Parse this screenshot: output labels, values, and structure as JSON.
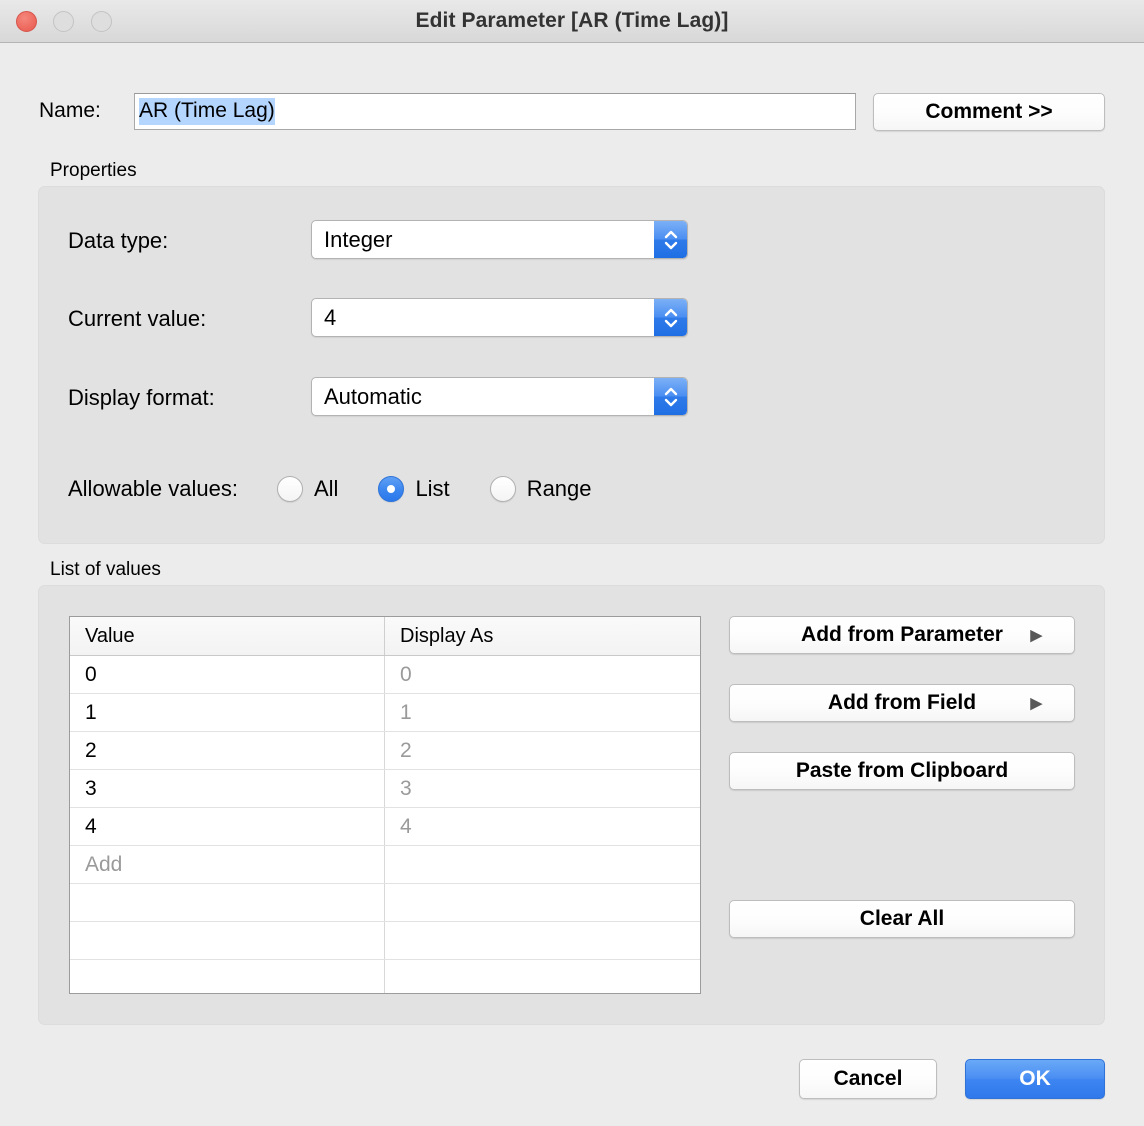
{
  "window": {
    "title": "Edit Parameter [AR (Time Lag)]",
    "controls": {
      "close": "close-button",
      "minimize": "minimize-button",
      "maximize": "maximize-button"
    }
  },
  "name_row": {
    "label": "Name:",
    "value": "AR (Time Lag)",
    "selected": true,
    "comment_button": "Comment >>"
  },
  "properties": {
    "group_label": "Properties",
    "data_type": {
      "label": "Data type:",
      "value": "Integer"
    },
    "current_value": {
      "label": "Current value:",
      "value": "4"
    },
    "display_format": {
      "label": "Display format:",
      "value": "Automatic"
    },
    "allowable_values": {
      "label": "Allowable values:",
      "options": [
        {
          "label": "All",
          "selected": false
        },
        {
          "label": "List",
          "selected": true
        },
        {
          "label": "Range",
          "selected": false
        }
      ]
    }
  },
  "list_of_values": {
    "group_label": "List of values",
    "columns": [
      "Value",
      "Display As"
    ],
    "rows": [
      {
        "value": "0",
        "display_as": "0"
      },
      {
        "value": "1",
        "display_as": "1"
      },
      {
        "value": "2",
        "display_as": "2"
      },
      {
        "value": "3",
        "display_as": "3"
      },
      {
        "value": "4",
        "display_as": "4"
      }
    ],
    "add_row_placeholder": "Add",
    "empty_rows": 3,
    "buttons": {
      "add_from_parameter": "Add from Parameter",
      "add_from_field": "Add from Field",
      "paste_from_clipboard": "Paste from Clipboard",
      "clear_all": "Clear All",
      "submenu_arrow": "▶"
    }
  },
  "footer": {
    "cancel": "Cancel",
    "ok": "OK"
  },
  "colors": {
    "accent_blue": "#3d85f1",
    "selection_blue": "#b4d5fe",
    "dialog_background": "#ececec",
    "group_background": "#e2e2e2",
    "close_button_red": "#ee6a5f"
  }
}
